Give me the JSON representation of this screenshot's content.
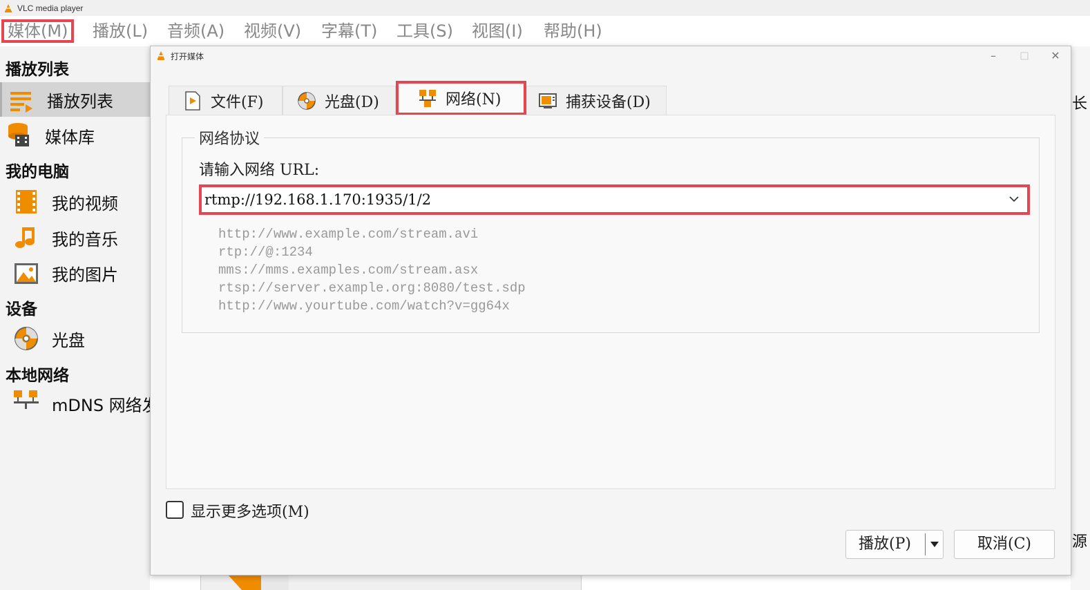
{
  "app": {
    "title": "VLC media player"
  },
  "menubar": {
    "items": [
      "媒体(M)",
      "播放(L)",
      "音频(A)",
      "视频(V)",
      "字幕(T)",
      "工具(S)",
      "视图(I)",
      "帮助(H)"
    ]
  },
  "sidebar": {
    "sections": [
      {
        "title": "播放列表",
        "items": [
          {
            "label": "播放列表",
            "icon": "playlist-icon",
            "selected": true
          },
          {
            "label": "媒体库",
            "icon": "media-library-icon"
          }
        ]
      },
      {
        "title": "我的电脑",
        "items": [
          {
            "label": "我的视频",
            "icon": "film-icon"
          },
          {
            "label": "我的音乐",
            "icon": "music-note-icon"
          },
          {
            "label": "我的图片",
            "icon": "picture-icon"
          }
        ]
      },
      {
        "title": "设备",
        "items": [
          {
            "label": "光盘",
            "icon": "disc-icon"
          }
        ]
      },
      {
        "title": "本地网络",
        "items": [
          {
            "label": "mDNS 网络发",
            "icon": "network-icon"
          }
        ]
      }
    ]
  },
  "behind": {
    "right_top_char": "长",
    "right_bottom_char": "源"
  },
  "dialog": {
    "title": "打开媒体",
    "tabs": [
      {
        "label": "文件(F)",
        "icon": "file-play-icon"
      },
      {
        "label": "光盘(D)",
        "icon": "disc-icon"
      },
      {
        "label": "网络(N)",
        "icon": "network-icon",
        "active": true
      },
      {
        "label": "捕获设备(D)",
        "icon": "capture-device-icon"
      }
    ],
    "group_title": "网络协议",
    "url_label": "请输入网络 URL:",
    "url_value": "rtmp://192.168.1.170:1935/1/2",
    "examples": [
      "http://www.example.com/stream.avi",
      "rtp://@:1234",
      "mms://mms.examples.com/stream.asx",
      "rtsp://server.example.org:8080/test.sdp",
      "http://www.yourtube.com/watch?v=gg64x"
    ],
    "show_more_label": "显示更多选项(M)",
    "show_more_checked": false,
    "play_label": "播放(P)",
    "cancel_label": "取消(C)"
  },
  "colors": {
    "accent_orange": "#f08c00",
    "highlight_red": "#e64651"
  }
}
